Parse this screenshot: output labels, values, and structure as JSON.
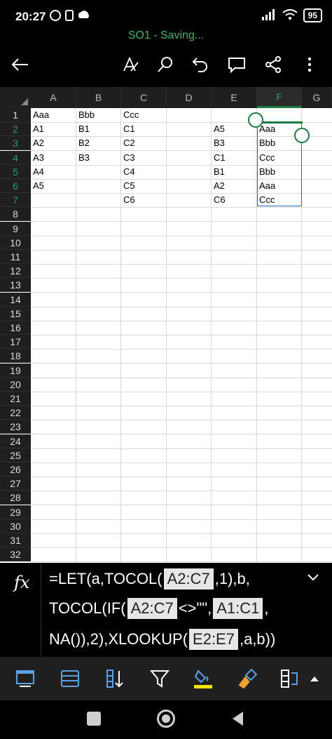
{
  "status_bar": {
    "time": "20:27",
    "battery": "95"
  },
  "document": {
    "title": "SO1 - Saving..."
  },
  "toolbar": {
    "icons": [
      "back-arrow-icon",
      "draw-icon",
      "search-icon",
      "undo-icon",
      "comment-icon",
      "share-icon",
      "more-icon"
    ]
  },
  "sheet": {
    "columns": [
      "A",
      "B",
      "C",
      "D",
      "E",
      "F",
      "G"
    ],
    "selected_column": "F",
    "rows": [
      "1",
      "2",
      "3",
      "4",
      "5",
      "6",
      "7",
      "8",
      "9",
      "10",
      "11",
      "12",
      "13",
      "14",
      "15",
      "16",
      "17",
      "18",
      "19",
      "20",
      "21",
      "22",
      "23",
      "24",
      "25",
      "26",
      "27",
      "28",
      "29",
      "30",
      "31",
      "32"
    ],
    "selected_rows": [
      "2",
      "3",
      "4",
      "5",
      "6",
      "7"
    ],
    "cells": {
      "A": [
        "Aaa",
        "A1",
        "A2",
        "A3",
        "A4",
        "A5"
      ],
      "B": [
        "Bbb",
        "B1",
        "B2",
        "B3"
      ],
      "C": [
        "Ccc",
        "C1",
        "C2",
        "C3",
        "C4",
        "C5",
        "C6"
      ],
      "E": [
        "",
        "A5",
        "B3",
        "C1",
        "B1",
        "A2",
        "C6"
      ],
      "F": [
        "",
        "Aaa",
        "Bbb",
        "Ccc",
        "Bbb",
        "Aaa",
        "Ccc"
      ]
    }
  },
  "formula_bar": {
    "fx_label": "fx",
    "line1": {
      "t1": "=LET(a,TOCOL(",
      "r1": "A2:C7",
      "t2": ",1),b,"
    },
    "line2": {
      "t1": "TOCOL(IF(",
      "r1": "A2:C7",
      "t2": "<>\"\",",
      "r2": "A1:C1",
      "t3": ","
    },
    "line3": {
      "t1": "NA()),2),XLOOKUP(",
      "r1": "E2:E7",
      "t2": ",a,b))"
    }
  },
  "colors": {
    "accent": "#2e9e58",
    "title_green": "#3fb66a",
    "fill_yellow": "#f5e400"
  }
}
